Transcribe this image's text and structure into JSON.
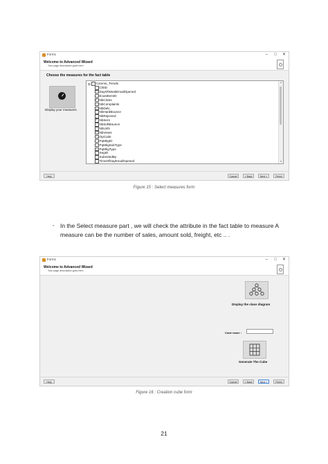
{
  "figure15": {
    "window": {
      "title": "Form1",
      "minimize": "–",
      "maximize": "□",
      "close": "✕",
      "header_title": "Welcome to Advanced Wizard",
      "header_subtitle": "Your page description goes here"
    },
    "section_title": "Choose the measures for the fact table",
    "display_label": "Display your measures",
    "tree_root": "Comms_Trends",
    "items": [
      {
        "label": "ChlID",
        "checked": false
      },
      {
        "label": "DayOfWeekEmailOpened",
        "checked": false
      },
      {
        "label": "EcastItemID",
        "checked": false
      },
      {
        "label": "NbClicks",
        "checked": true
      },
      {
        "label": "NbComplaints",
        "checked": false
      },
      {
        "label": "NbDelv",
        "checked": false
      },
      {
        "label": "NbHardBounce",
        "checked": false
      },
      {
        "label": "NbRejected",
        "checked": false
      },
      {
        "label": "NbSent",
        "checked": true
      },
      {
        "label": "NbSoftBounce",
        "checked": false
      },
      {
        "label": "NbUnfs",
        "checked": false
      },
      {
        "label": "NbViews",
        "checked": false
      },
      {
        "label": "OpCode",
        "checked": false
      },
      {
        "label": "PqMkgID",
        "checked": false
      },
      {
        "label": "PqMkgSubType",
        "checked": false
      },
      {
        "label": "PqMkgType",
        "checked": false
      },
      {
        "label": "SegID",
        "checked": false
      },
      {
        "label": "SubmitedBy",
        "checked": false
      },
      {
        "label": "TimeOfDayEmailOpened",
        "checked": false
      }
    ],
    "buttons": {
      "help": "Help",
      "cancel": "Cancel",
      "back": "< Back",
      "next": "Next >",
      "finish": "Finish"
    },
    "caption": "Figure 15 : Select measures form"
  },
  "body": {
    "bullet": "-",
    "paragraph": "In the Select measure part , we will check the attribute in the fact table to measure A measure can be the number of sales, amount sold, freight, etc .. ."
  },
  "figure16": {
    "window": {
      "title": "Form1",
      "minimize": "–",
      "maximize": "□",
      "close": "✕",
      "header_title": "Welcome to Advanced Wizard",
      "header_subtitle": "Your page description goes here"
    },
    "display_class_label": "Display the class diagram",
    "cube_name_label": "Cube name :",
    "cube_name_value": "",
    "generate_label": "Generate The Cube",
    "buttons": {
      "help": "Help",
      "cancel": "Cancel",
      "back": "< Back",
      "next": "Next >",
      "finish": "Finish"
    },
    "caption": "Figure 16 : Creation cube form"
  },
  "page_number": "21"
}
